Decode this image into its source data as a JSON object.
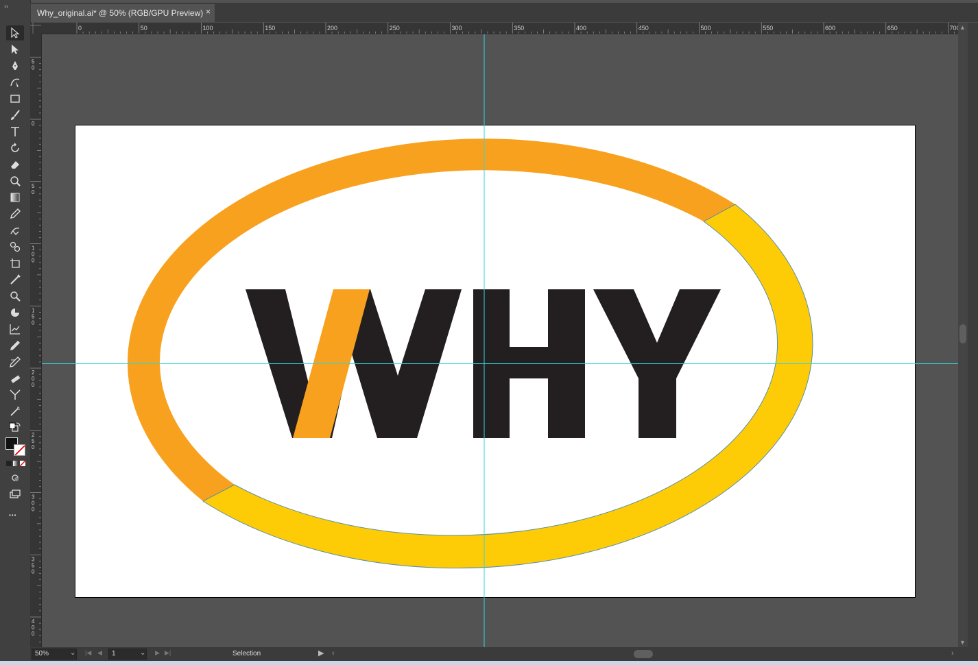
{
  "document": {
    "tab_title": "Why_original.ai* @ 50% (RGB/GPU Preview)",
    "close_glyph": "×"
  },
  "toolbar": {
    "top_glyph": "››",
    "tools": [
      "selection-tool",
      "direct-selection-tool",
      "pen-tool",
      "curvature-tool",
      "rectangle-tool",
      "paintbrush-tool",
      "type-tool",
      "rotate-tool",
      "eraser-tool",
      "warp-tool",
      "gradient-tool",
      "eyedropper-tool",
      "shape-builder-tool",
      "live-paint-tool",
      "artboard-tool",
      "measure-tool",
      "zoom-tool",
      "pie-graph-tool",
      "line-graph-tool",
      "pencil-tool",
      "width-tool",
      "knife-tool",
      "blend-tool",
      "symbol-sprayer-tool"
    ],
    "more_glyph": "•••"
  },
  "rulers": {
    "horizontal_labels": [
      "0",
      "50",
      "100",
      "150",
      "200",
      "250",
      "300",
      "350",
      "400",
      "450",
      "500",
      "550",
      "600",
      "650",
      "700"
    ],
    "vertical_labels": [
      "5 0",
      "0",
      "5 0",
      "1 0 0",
      "1 5 0",
      "2 0 0",
      "2 5 0",
      "3 0 0",
      "3 5 0",
      "4 0 0"
    ]
  },
  "artwork": {
    "text": "WHY",
    "colors": {
      "orange": "#F7A11E",
      "yellow": "#FECC07",
      "black": "#231F20",
      "guide": "#34D5DA",
      "artboard": "#FFFFFF"
    }
  },
  "status_bar": {
    "zoom": "50%",
    "page": "1",
    "tool_status": "Selection"
  }
}
